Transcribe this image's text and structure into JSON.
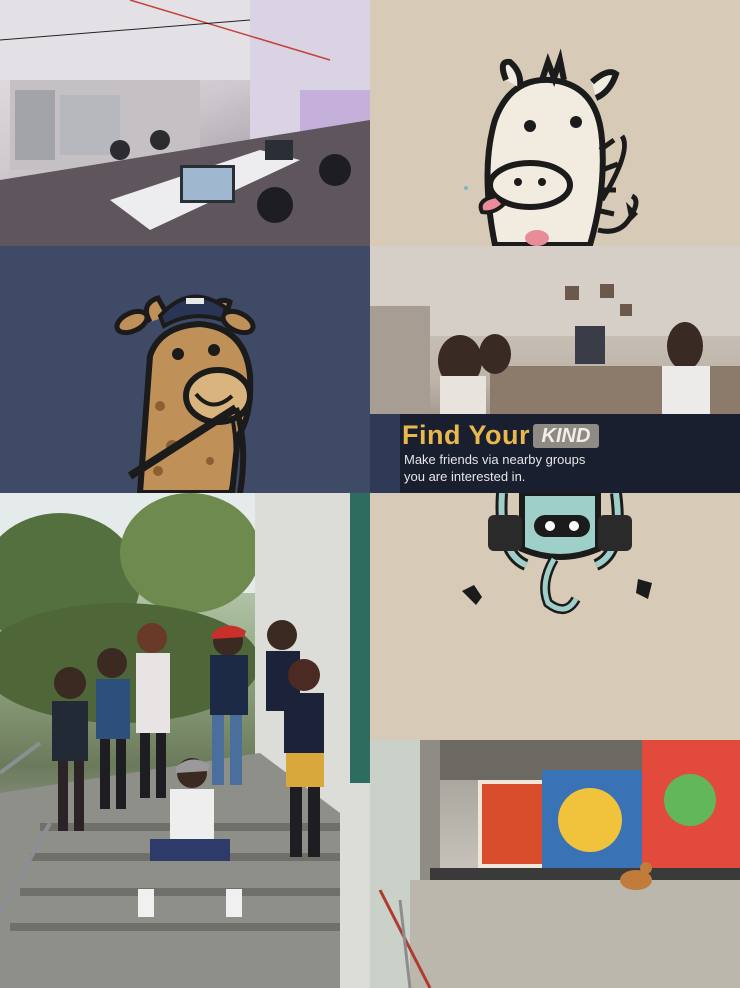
{
  "tiles": [
    {
      "id": "office-photo",
      "description_icon": "photo-icon"
    },
    {
      "id": "zebra-mascot",
      "bg": "#d7cbb7"
    },
    {
      "id": "giraffe-mascot",
      "bg": "#3e4a66"
    },
    {
      "id": "office-workers-photo"
    },
    {
      "id": "girls-group-photo"
    },
    {
      "id": "robot-mascot",
      "bg": "#d7cbb7"
    },
    {
      "id": "graffiti-cafe-photo"
    }
  ],
  "banner": {
    "title": "Find Your",
    "badge": "KIND",
    "line1": "Make friends via nearby groups",
    "line2": "you  are interested in."
  },
  "colors": {
    "beige": "#d7cbb7",
    "navy": "#3e4a66",
    "banner_bg": "#1a1f2f",
    "banner_title": "#e8b84e"
  }
}
